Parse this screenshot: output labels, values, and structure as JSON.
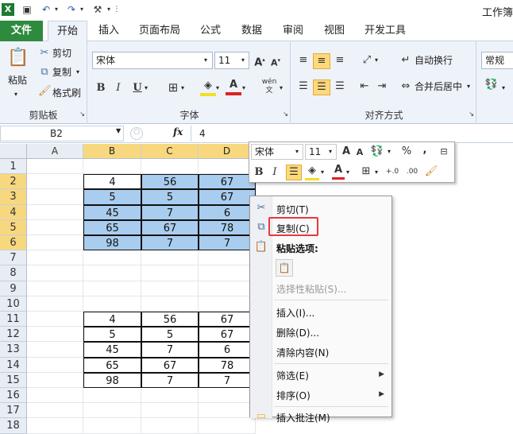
{
  "window": {
    "title": "工作簿"
  },
  "ribbon_tabs": [
    "文件",
    "开始",
    "插入",
    "页面布局",
    "公式",
    "数据",
    "审阅",
    "视图",
    "开发工具"
  ],
  "clipboard": {
    "paste": "粘贴",
    "cut": "剪切",
    "copy": "复制",
    "format_painter": "格式刷",
    "label": "剪贴板"
  },
  "font": {
    "name": "宋体",
    "size": "11",
    "bold": "B",
    "italic": "I",
    "underline": "U",
    "label": "字体",
    "wen": "wén"
  },
  "alignment": {
    "wrap": "自动换行",
    "merge": "合并后居中",
    "label": "对齐方式"
  },
  "number": {
    "format": "常规"
  },
  "formula_bar": {
    "name_box": "B2",
    "fx": "fx",
    "value": "4"
  },
  "grid": {
    "columns": [
      "A",
      "B",
      "C",
      "D"
    ],
    "rows": [
      "1",
      "2",
      "3",
      "4",
      "5",
      "6",
      "7",
      "8",
      "9",
      "10",
      "11",
      "12",
      "13",
      "14",
      "15",
      "16",
      "17",
      "18"
    ],
    "table1": [
      [
        "4",
        "56",
        "67"
      ],
      [
        "5",
        "5",
        "67"
      ],
      [
        "45",
        "7",
        "6"
      ],
      [
        "65",
        "67",
        "78"
      ],
      [
        "98",
        "7",
        "7"
      ]
    ],
    "table2": [
      [
        "4",
        "56",
        "67"
      ],
      [
        "5",
        "5",
        "67"
      ],
      [
        "45",
        "7",
        "6"
      ],
      [
        "65",
        "67",
        "78"
      ],
      [
        "98",
        "7",
        "7"
      ]
    ]
  },
  "mini_toolbar": {
    "font": "宋体",
    "size": "11",
    "percent": "%",
    "comma": ","
  },
  "context_menu": {
    "cut": "剪切(T)",
    "copy": "复制(C)",
    "paste_options": "粘贴选项:",
    "paste_special": "选择性粘贴(S)...",
    "insert": "插入(I)...",
    "delete": "删除(D)...",
    "clear": "清除内容(N)",
    "filter": "筛选(E)",
    "sort": "排序(O)",
    "comment": "插入批注(M)"
  },
  "colors": {
    "accent_file": "#2e8b3e",
    "selection": "#a9cdee",
    "header_selected": "#f8d87f",
    "highlight_box": "#e8383d"
  }
}
